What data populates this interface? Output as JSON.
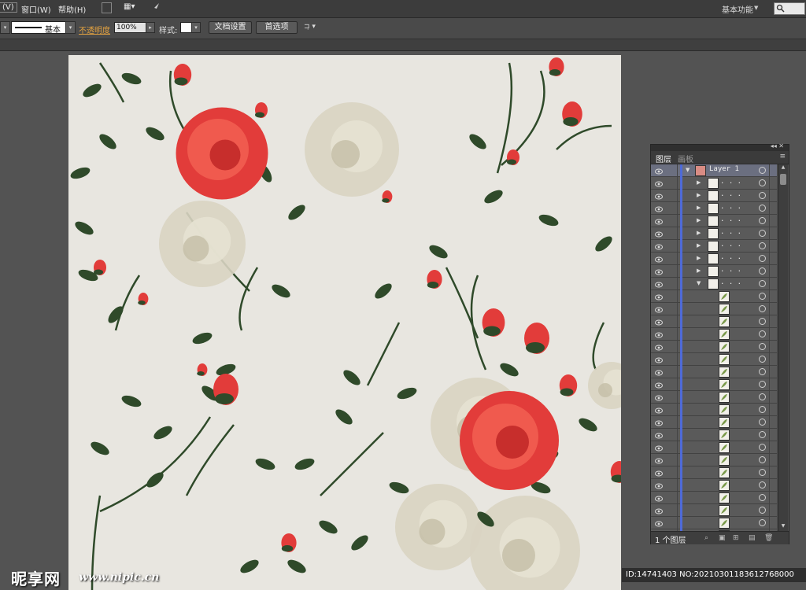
{
  "menubar": {
    "items": [
      "(V)",
      "窗口(W)",
      "帮助(H)"
    ],
    "workspace": "基本功能"
  },
  "controlbar": {
    "stroke_profile": "基本",
    "opacity_label": "不透明度",
    "opacity_value": "100%",
    "style_label": "样式:",
    "doc_setup_button": "文档设置",
    "preferences_button": "首选项"
  },
  "layers_panel": {
    "tabs": [
      "图层",
      "画板"
    ],
    "top_layer": "Layer 1",
    "collapsed_group_label": ". . .",
    "layer_count": "1 个图层"
  },
  "watermark": {
    "logo": "昵享网",
    "url": "www.nipic.cn",
    "id_text": "ID:14741403 NO:20210301183612768000"
  },
  "colors": {
    "canvas_bg": "#e8e6e0",
    "rose_red": "#e23c3a",
    "leaf_green": "#2f4a2a",
    "peony_cream": "#d9d4c2",
    "layer_color_bar": "#4e6ad8"
  }
}
